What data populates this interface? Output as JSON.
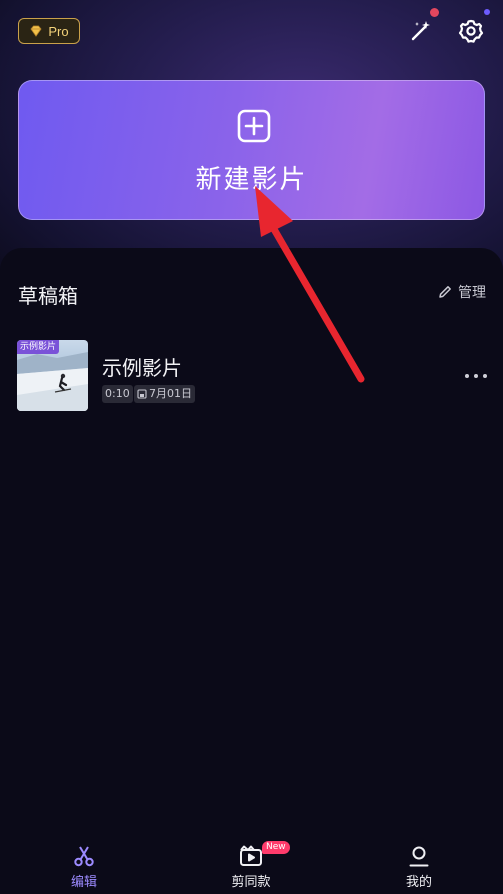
{
  "header": {
    "pro_label": "Pro",
    "icons": [
      "gem-icon",
      "magic-wand-icon",
      "gear-icon"
    ]
  },
  "new_movie": {
    "label": "新建影片",
    "icon": "plus-square-icon"
  },
  "drafts": {
    "title": "草稿箱",
    "manage_label": "管理",
    "items": [
      {
        "tag": "示例影片",
        "name": "示例影片",
        "duration": "0:10",
        "date": "7月01日"
      }
    ]
  },
  "bottom_nav": {
    "items": [
      {
        "label": "编辑",
        "icon": "scissors-icon",
        "active": true
      },
      {
        "label": "剪同款",
        "icon": "template-video-icon",
        "badge": "New"
      },
      {
        "label": "我的",
        "icon": "user-icon"
      }
    ]
  },
  "colors": {
    "accent": "#9d8bff",
    "card_gradient_start": "#6f5af0",
    "card_gradient_end": "#a36ce6",
    "annotation_arrow": "#e8262f",
    "background": "#0b0a18"
  }
}
